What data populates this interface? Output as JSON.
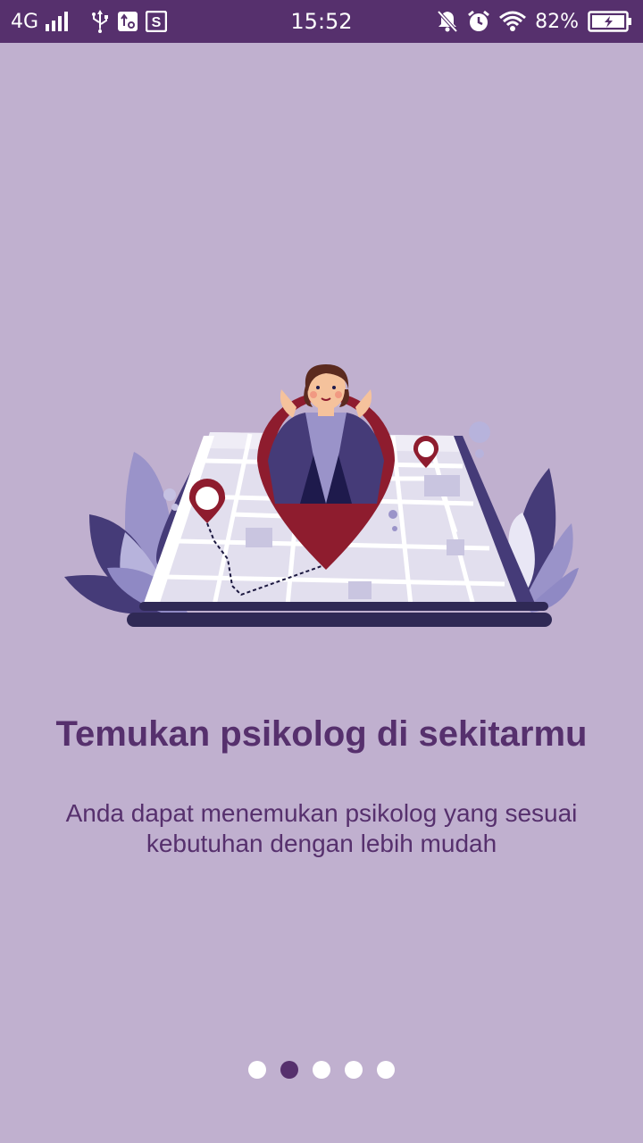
{
  "status_bar": {
    "network": "4G",
    "time": "15:52",
    "battery": "82%",
    "icons": [
      "signal-icon",
      "usb-icon",
      "usb-settings-icon",
      "s-app-icon",
      "mute-icon",
      "alarm-icon",
      "wifi-icon",
      "battery-charging-icon"
    ]
  },
  "onboarding": {
    "title": "Temukan psikolog di sekitarmu",
    "subtitle": "Anda dapat menemukan psikolog yang sesuai kebutuhan dengan lebih mudah",
    "illustration": "map-location-pin-person-illustration",
    "page_count": 5,
    "active_page": 2
  },
  "colors": {
    "background": "#c0b0cf",
    "status_bar": "#56306d",
    "accent": "#56306d",
    "pin": "#8e1c2e",
    "dot_inactive": "#ffffff"
  }
}
